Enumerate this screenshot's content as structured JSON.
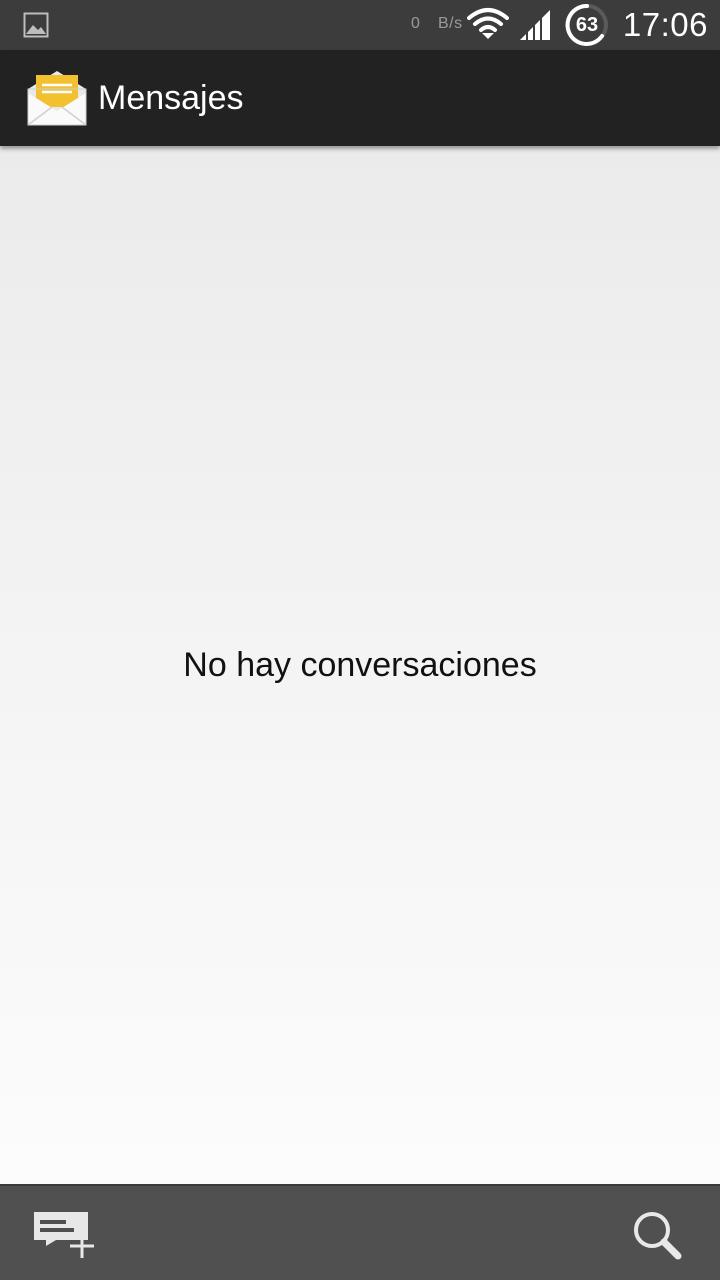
{
  "status_bar": {
    "net_speed_value": "0",
    "net_speed_unit": "B/s",
    "battery_level": "63",
    "clock": "17:06",
    "icons": [
      "gallery-notification-icon",
      "wifi-icon",
      "signal-icon",
      "battery-ring-icon"
    ]
  },
  "action_bar": {
    "title": "Mensajes",
    "icon": "envelope-icon"
  },
  "content": {
    "empty_message": "No hay conversaciones"
  },
  "bottom_bar": {
    "icons": [
      "new-message-icon",
      "search-icon"
    ]
  },
  "colors": {
    "status_bar_bg": "#3c3c3c",
    "action_bar_bg": "#222222",
    "bottom_bar_bg": "#505050",
    "envelope_yellow": "#f3c12f"
  }
}
